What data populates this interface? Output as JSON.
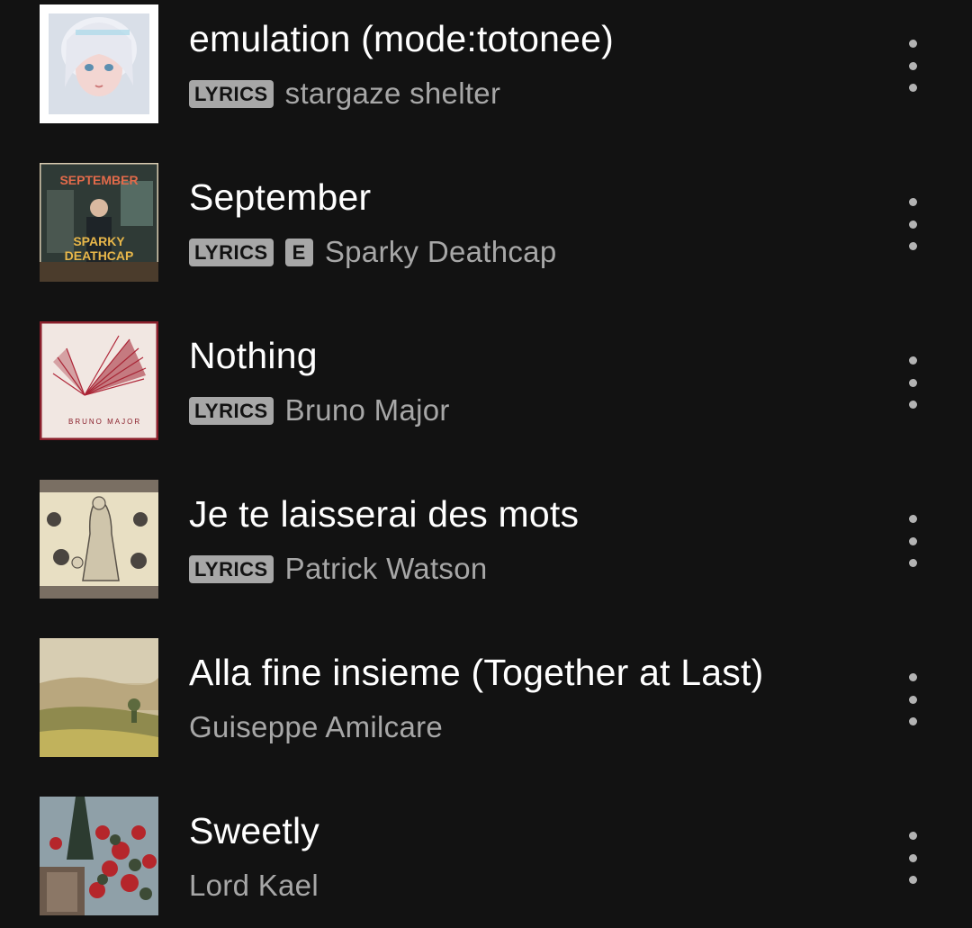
{
  "tracks": [
    {
      "title": "emulation (mode:totonee)",
      "lyrics_badge": "LYRICS",
      "explicit_badge": "",
      "artist": "stargaze shelter",
      "art_icon": "anime-girl-portrait"
    },
    {
      "title": "September",
      "lyrics_badge": "LYRICS",
      "explicit_badge": "E",
      "artist": "Sparky Deathcap",
      "art_icon": "room-scene",
      "art_text": [
        "SEPTEMBER",
        "SPARKY",
        "DEATHCAP"
      ]
    },
    {
      "title": "Nothing",
      "lyrics_badge": "LYRICS",
      "explicit_badge": "",
      "artist": "Bruno Major",
      "art_icon": "red-fan-lines",
      "art_text": [
        "BRUNO MAJOR"
      ]
    },
    {
      "title": "Je te laisserai des mots",
      "lyrics_badge": "LYRICS",
      "explicit_badge": "",
      "artist": "Patrick Watson",
      "art_icon": "vintage-floral-illustration"
    },
    {
      "title": "Alla fine insieme (Together at Last)",
      "lyrics_badge": "",
      "explicit_badge": "",
      "artist": "Guiseppe Amilcare",
      "art_icon": "tuscan-landscape"
    },
    {
      "title": "Sweetly",
      "lyrics_badge": "",
      "explicit_badge": "",
      "artist": "Lord Kael",
      "art_icon": "red-flowers-photo"
    }
  ],
  "more_icon": "more-vertical-icon",
  "colors": {
    "background": "#121212",
    "title": "#ffffff",
    "subtitle": "#a7a7a7",
    "badge": "#a7a7a7"
  }
}
